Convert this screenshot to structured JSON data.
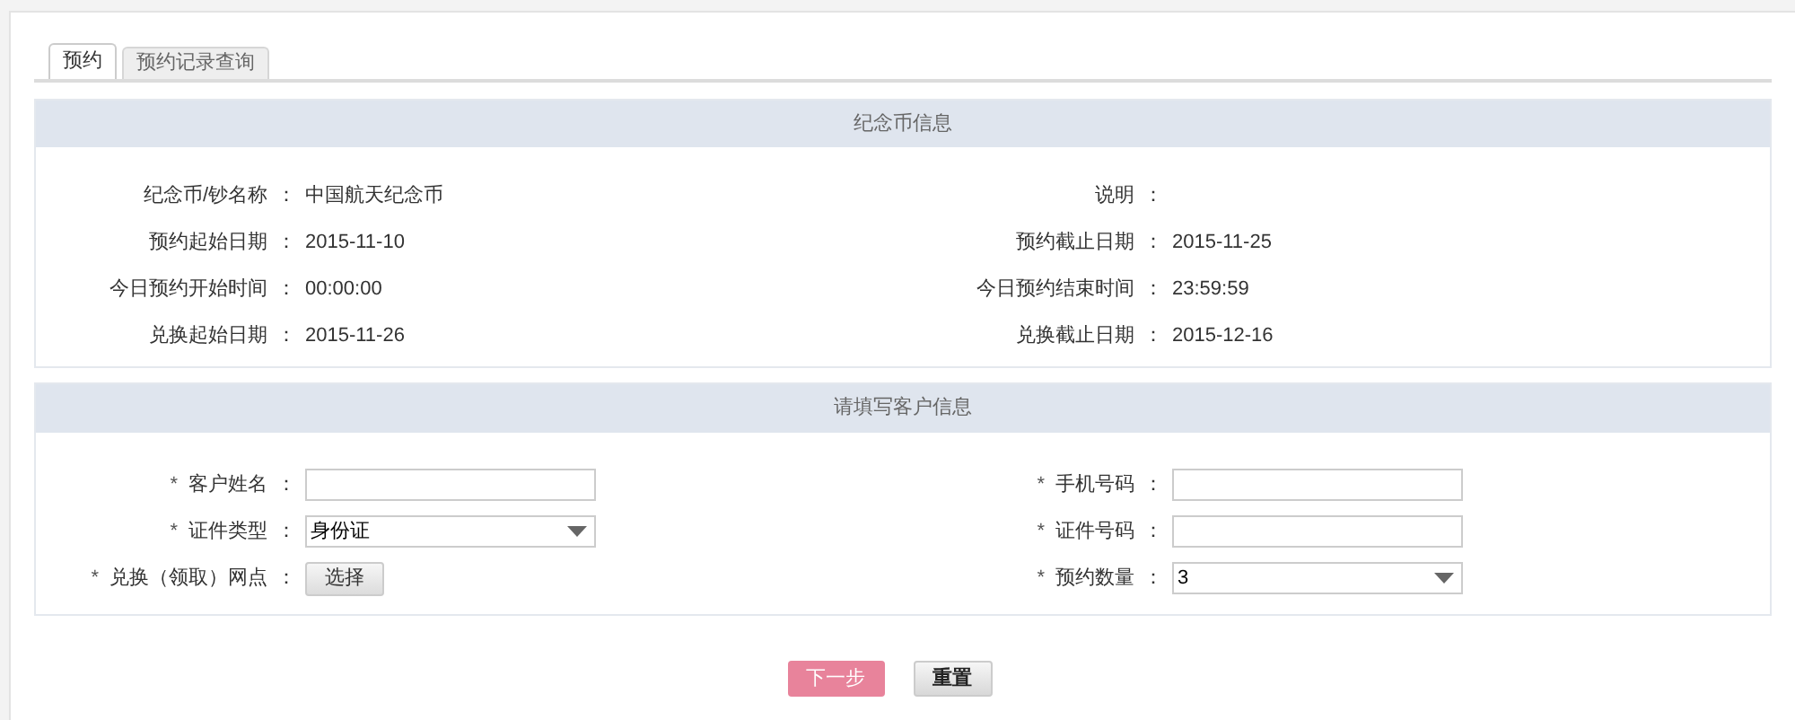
{
  "tabs": [
    {
      "label": "预约",
      "selected": true
    },
    {
      "label": "预约记录查询",
      "selected": false
    }
  ],
  "coin_info": {
    "title": "纪念币信息",
    "fields": [
      {
        "label": "纪念币/钞名称",
        "colon": "：",
        "value": "中国航天纪念币"
      },
      {
        "label": "说明",
        "colon": "："
      },
      {
        "label": "预约起始日期",
        "colon": "：",
        "value": "2015-11-10"
      },
      {
        "label": "预约截止日期",
        "colon": "：",
        "value": "2015-11-25"
      },
      {
        "label": "今日预约开始时间",
        "colon": "：",
        "value": "00:00:00"
      },
      {
        "label": "今日预约结束时间",
        "colon": "：",
        "value": "23:59:59"
      },
      {
        "label": "兑换起始日期",
        "colon": "：",
        "value": "2015-11-26"
      },
      {
        "label": "兑换截止日期",
        "colon": "：",
        "value": "2015-12-16"
      }
    ]
  },
  "customer_info": {
    "title": "请填写客户信息",
    "fields": [
      {
        "kind": "text",
        "mark": "*",
        "label": "客户姓名",
        "colon": "："
      },
      {
        "kind": "text",
        "mark": "*",
        "label": "手机号码",
        "colon": "："
      },
      {
        "kind": "select",
        "mark": "*",
        "label": "证件类型",
        "colon": "：",
        "value": "身份证"
      },
      {
        "kind": "text",
        "mark": "*",
        "label": "证件号码",
        "colon": "："
      },
      {
        "kind": "button",
        "mark": "*",
        "label": "兑换（领取）网点",
        "colon": "：",
        "button": "选择"
      },
      {
        "kind": "select",
        "mark": "*",
        "label": "预约数量",
        "colon": "：",
        "value": "3"
      }
    ]
  },
  "buttons": [
    {
      "kind": "primary",
      "label": "下一步"
    },
    {
      "kind": "secondary",
      "label": "重置"
    }
  ]
}
